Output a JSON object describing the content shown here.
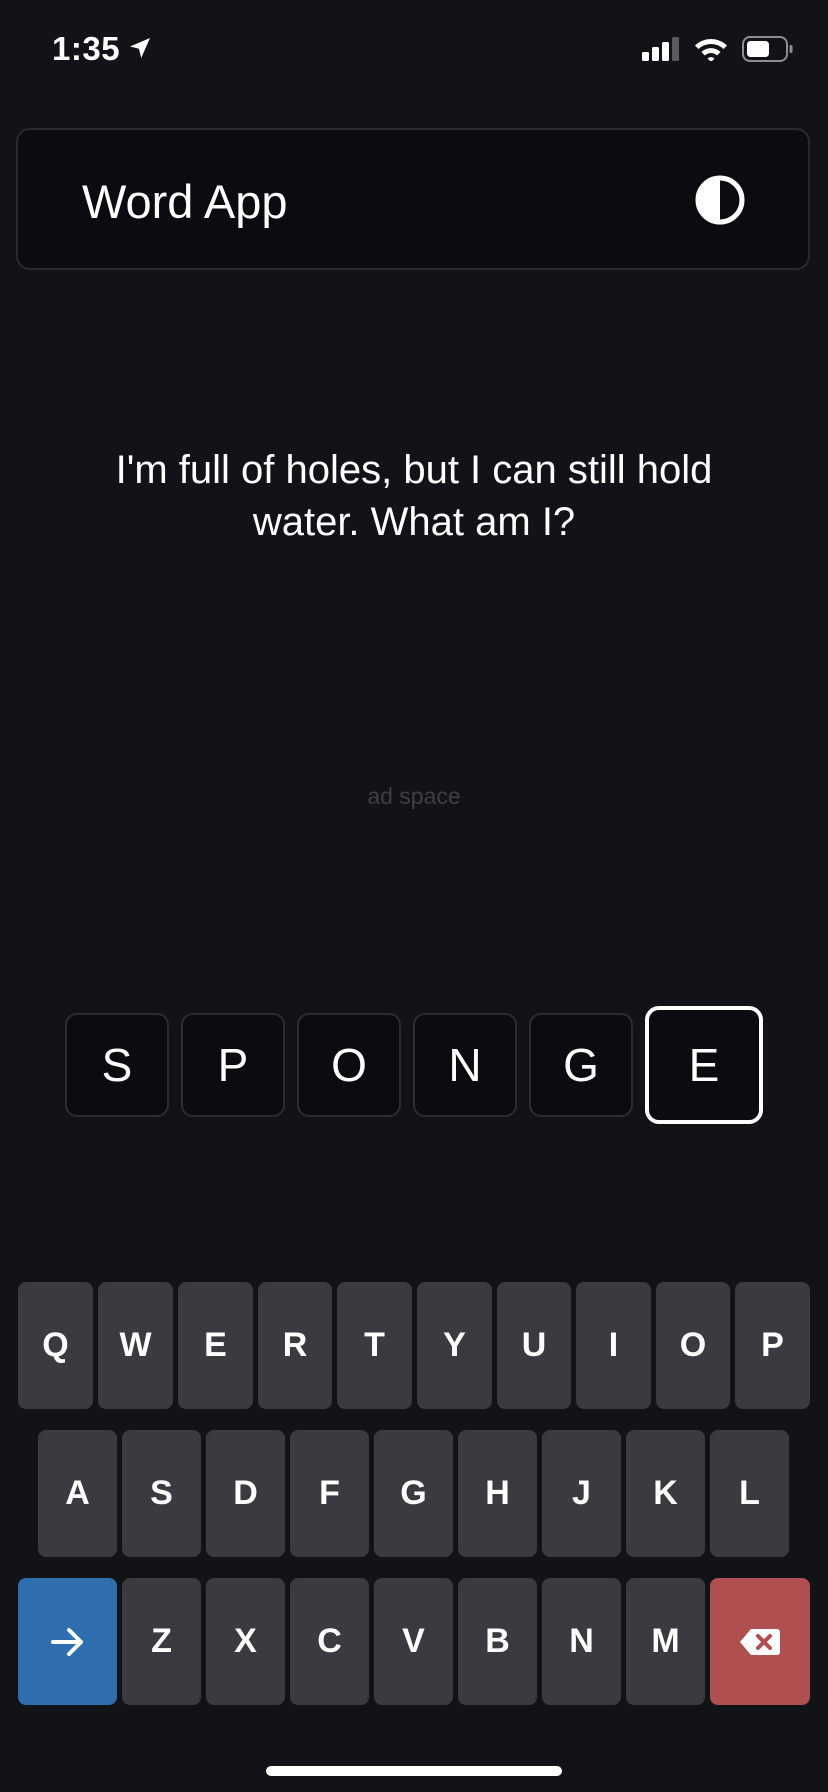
{
  "status": {
    "time": "1:35",
    "icons": [
      "location-arrow-icon",
      "cellular-signal-icon",
      "wifi-icon",
      "battery-icon"
    ]
  },
  "header": {
    "title": "Word App",
    "theme_icon": "contrast-icon"
  },
  "riddle": {
    "text": "I'm full of holes, but I can still hold water. What am I?"
  },
  "ad": {
    "label": "ad space"
  },
  "answer": {
    "letters": [
      "S",
      "P",
      "O",
      "N",
      "G",
      "E"
    ],
    "active_index": 5
  },
  "keyboard": {
    "row1": [
      "Q",
      "W",
      "E",
      "R",
      "T",
      "Y",
      "U",
      "I",
      "O",
      "P"
    ],
    "row2": [
      "A",
      "S",
      "D",
      "F",
      "G",
      "H",
      "J",
      "K",
      "L"
    ],
    "row3": [
      "Z",
      "X",
      "C",
      "V",
      "B",
      "N",
      "M"
    ],
    "enter_icon": "arrow-right-icon",
    "backspace_icon": "backspace-icon"
  },
  "colors": {
    "background": "#121317",
    "key": "#3a3b3f",
    "enter_key": "#2f6eaf",
    "backspace_key": "#b04f4f",
    "active_tile_border": "#ffffff"
  }
}
